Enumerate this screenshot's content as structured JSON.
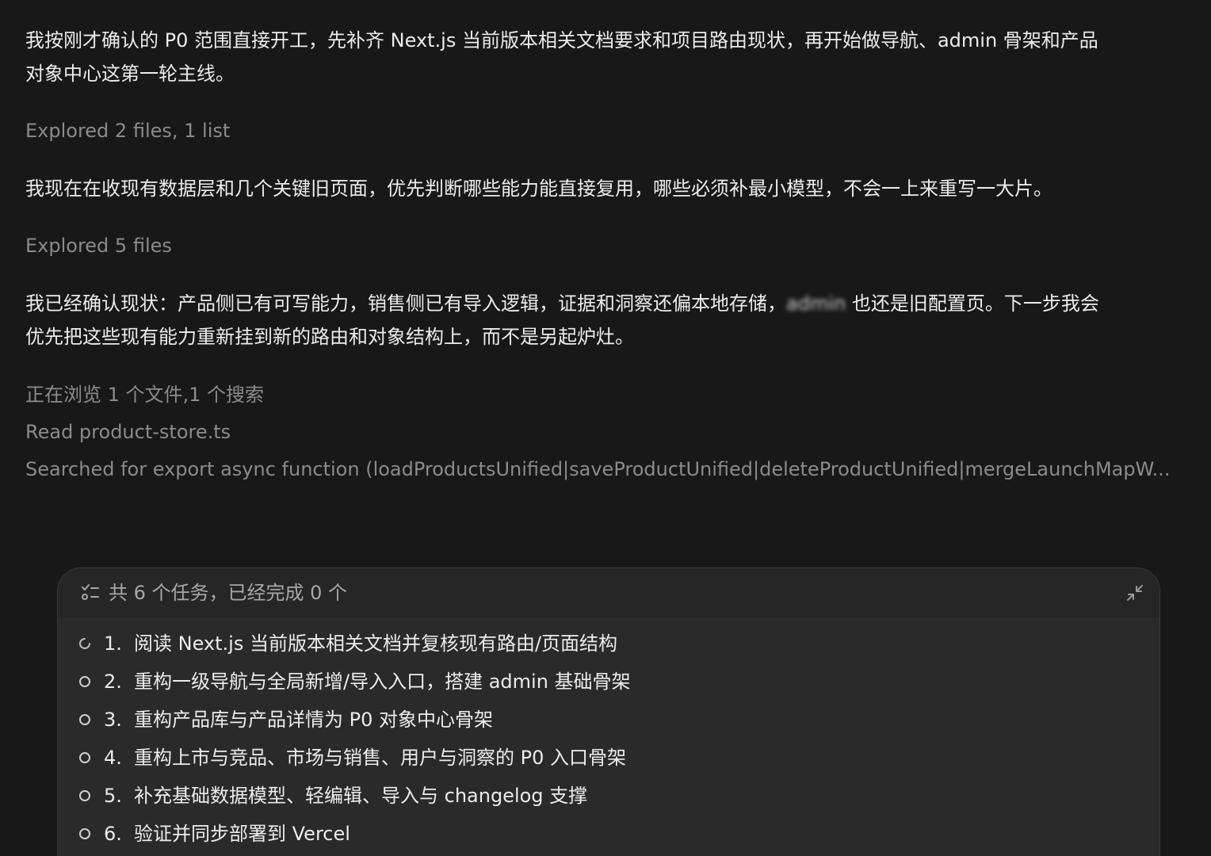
{
  "messages": [
    {
      "lines": [
        "我按刚才确认的 P0 范围直接开工，先补齐 Next.js 当前版本相关文档要求和项目路由现状，再开始做导航、admin 骨架和产品",
        "对象中心这第一轮主线。"
      ]
    },
    {
      "lines": [
        "我现在在收现有数据层和几个关键旧页面，优先判断哪些能力能直接复用，哪些必须补最小模型，不会一上来重写一大片。"
      ]
    },
    {
      "line1_before": "我已经确认现状：产品侧已有可写能力，销售侧已有导入逻辑，证据和洞察还偏本地存储，",
      "line1_blurred": "admin",
      "line1_after": " 也还是旧配置页。下一步我会",
      "line2": "优先把这些现有能力重新挂到新的路由和对象结构上，而不是另起炉灶。"
    }
  ],
  "explored": [
    "Explored 2 files, 1 list",
    "Explored 5 files"
  ],
  "browsing": {
    "status": "正在浏览 1 个文件,1 个搜索",
    "read": "Read product-store.ts",
    "searched": "Searched for export async function (loadProductsUnified|saveProductUnified|deleteProductUnified|mergeLaunchMapW..."
  },
  "tasks_panel": {
    "header": "共 6 个任务，已经完成 0 个",
    "header_icon": "checklist-icon",
    "collapse_icon": "collapse-icon",
    "tasks": [
      {
        "num": "1.",
        "text": "阅读 Next.js 当前版本相关文档并复核现有路由/页面结构",
        "status": "in-progress"
      },
      {
        "num": "2.",
        "text": "重构一级导航与全局新增/导入入口，搭建 admin 基础骨架",
        "status": "pending"
      },
      {
        "num": "3.",
        "text": "重构产品库与产品详情为 P0 对象中心骨架",
        "status": "pending"
      },
      {
        "num": "4.",
        "text": "重构上市与竞品、市场与销售、用户与洞察的 P0 入口骨架",
        "status": "pending"
      },
      {
        "num": "5.",
        "text": "补充基础数据模型、轻编辑、导入与 changelog 支撑",
        "status": "pending"
      },
      {
        "num": "6.",
        "text": "验证并同步部署到 Vercel",
        "status": "pending"
      }
    ]
  }
}
